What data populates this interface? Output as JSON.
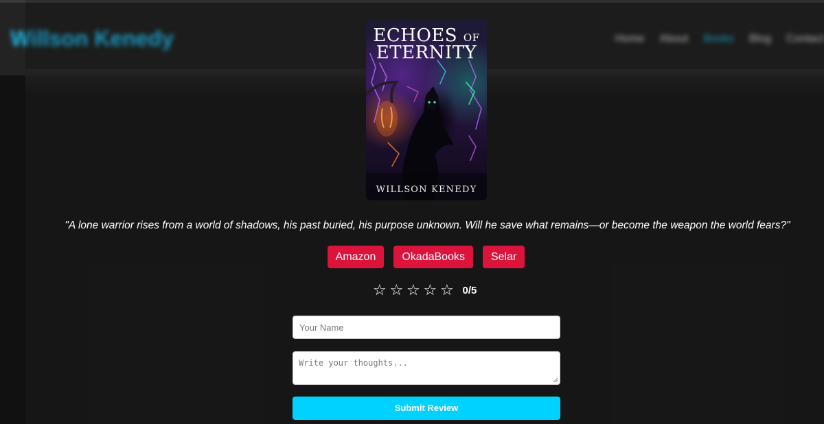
{
  "header": {
    "brand": "Willson Kenedy",
    "nav": [
      {
        "label": "Home",
        "active": false
      },
      {
        "label": "About",
        "active": false
      },
      {
        "label": "Books",
        "active": true
      },
      {
        "label": "Blog",
        "active": false
      },
      {
        "label": "Contact",
        "active": false
      }
    ]
  },
  "book": {
    "title_line1_big": "ECHOES",
    "title_line1_small": "OF",
    "title_line2": "ETERNITY",
    "author": "WILLSON KENEDY",
    "tagline": "\"A lone warrior rises from a world of shadows, his past buried, his purpose unknown. Will he save what remains—or become the weapon the world fears?\""
  },
  "stores": [
    {
      "label": "Amazon"
    },
    {
      "label": "OkadaBooks"
    },
    {
      "label": "Selar"
    }
  ],
  "rating": {
    "stars": [
      "☆",
      "☆",
      "☆",
      "☆",
      "☆"
    ],
    "display": "0/5"
  },
  "review_form": {
    "name_placeholder": "Your Name",
    "name_value": "",
    "thoughts_placeholder": "Write your thoughts...",
    "thoughts_value": "",
    "submit_label": "Submit Review"
  },
  "colors": {
    "accent": "#00d2ff",
    "store_button": "#dc143c",
    "background": "#1c1c1c",
    "brand": "#22b8e6"
  }
}
